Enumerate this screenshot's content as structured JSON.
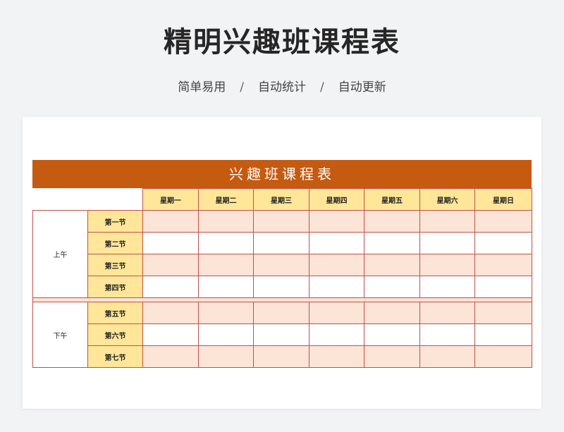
{
  "header": {
    "title": "精明兴趣班课程表",
    "tags": [
      "简单易用",
      "自动统计",
      "自动更新"
    ],
    "separator": "/"
  },
  "sheet": {
    "banner": "兴趣班课程表",
    "days": [
      "星期一",
      "星期二",
      "星期三",
      "星期四",
      "星期五",
      "星期六",
      "星期日"
    ],
    "morning": {
      "label": "上午",
      "periods": [
        "第一节",
        "第二节",
        "第三节",
        "第四节"
      ]
    },
    "afternoon": {
      "label": "下午",
      "periods": [
        "第五节",
        "第六节",
        "第七节"
      ]
    }
  },
  "colors": {
    "banner": "#c55a11",
    "header_fill": "#ffe699",
    "row_fill": "#fce4d6",
    "grid_line": "#c0504d"
  }
}
